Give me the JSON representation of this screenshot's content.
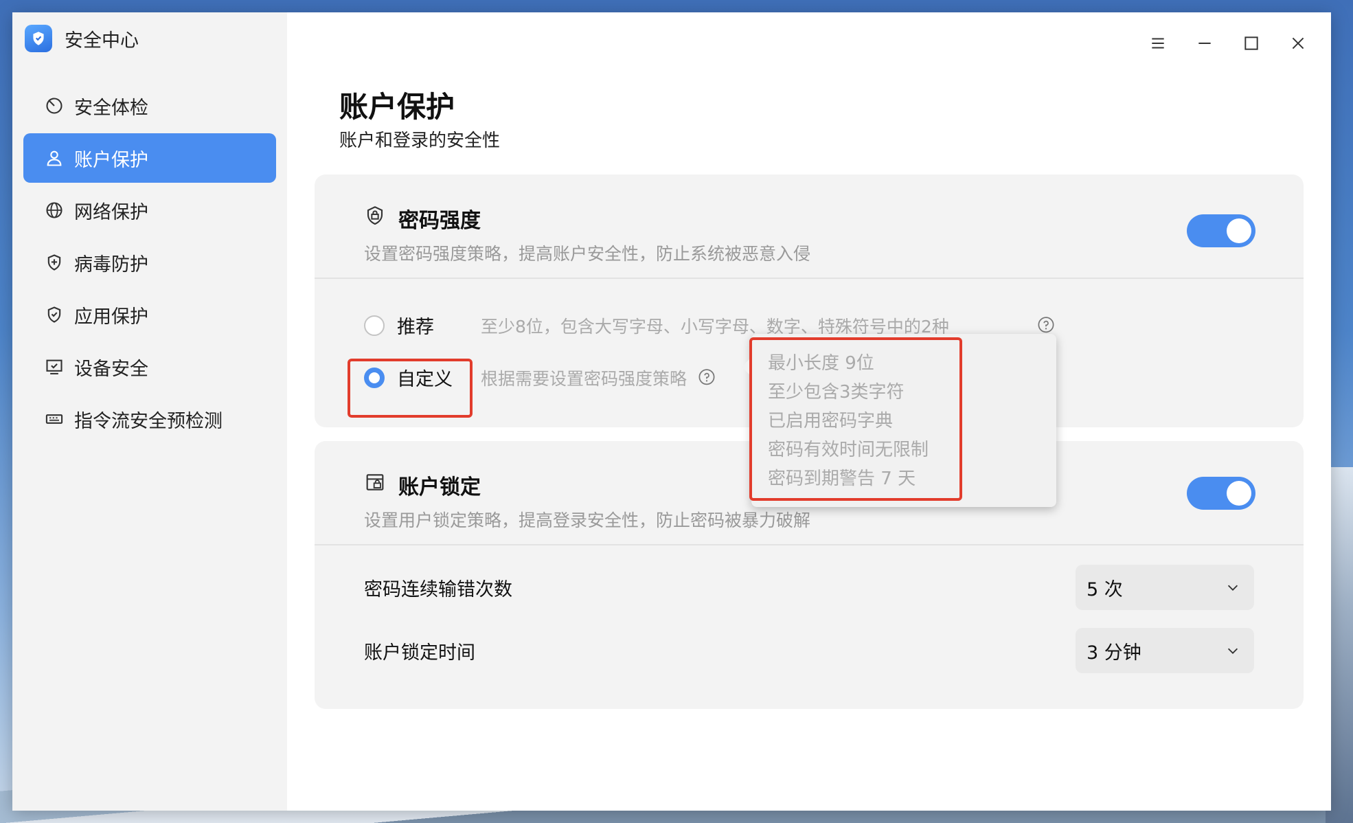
{
  "app": {
    "title": "安全中心"
  },
  "sidebar": {
    "items": [
      {
        "label": "安全体检",
        "icon": "scan-icon"
      },
      {
        "label": "账户保护",
        "icon": "user-icon"
      },
      {
        "label": "网络保护",
        "icon": "globe-icon"
      },
      {
        "label": "病毒防护",
        "icon": "shield-plus-icon"
      },
      {
        "label": "应用保护",
        "icon": "shield-check-icon"
      },
      {
        "label": "设备安全",
        "icon": "monitor-check-icon"
      },
      {
        "label": "指令流安全预检测",
        "icon": "keyboard-icon"
      }
    ],
    "active_index": 1
  },
  "page": {
    "title": "账户保护",
    "subtitle": "账户和登录的安全性"
  },
  "password_strength": {
    "title": "密码强度",
    "description": "设置密码强度策略，提高账户安全性，防止系统被恶意入侵",
    "enabled": true,
    "options": {
      "recommended": {
        "label": "推荐",
        "description": "至少8位，包含大写字母、小写字母、数字、特殊符号中的2种"
      },
      "custom": {
        "label": "自定义",
        "description": "根据需要设置密码强度策略"
      }
    },
    "selected": "custom",
    "tooltip_lines": [
      "最小长度 9位",
      "至少包含3类字符",
      "已启用密码字典",
      "密码有效时间无限制",
      "密码到期警告 7 天"
    ]
  },
  "account_lock": {
    "title": "账户锁定",
    "description": "设置用户锁定策略，提高登录安全性，防止密码被暴力破解",
    "enabled": true,
    "fields": [
      {
        "label": "密码连续输错次数",
        "value": "5 次"
      },
      {
        "label": "账户锁定时间",
        "value": "3 分钟"
      }
    ]
  },
  "colors": {
    "accent": "#4a8df0",
    "highlight": "#e23c2c",
    "sidebar_bg": "#f3f3f3"
  }
}
